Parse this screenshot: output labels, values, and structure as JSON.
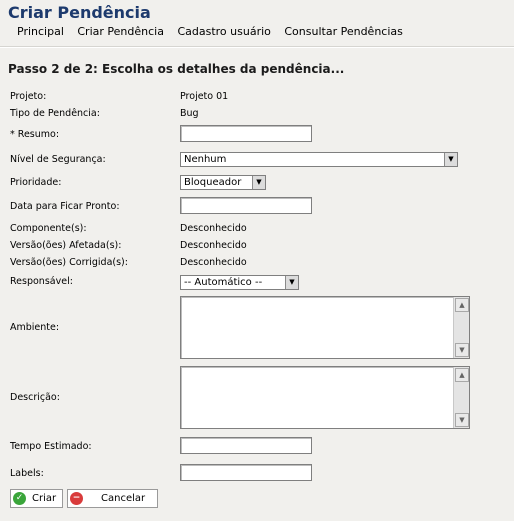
{
  "app": {
    "title": "Criar Pendência"
  },
  "nav": {
    "items": [
      "Principal",
      "Criar Pendência",
      "Cadastro usuário",
      "Consultar Pendências"
    ]
  },
  "page": {
    "step_title": "Passo 2 de 2: Escolha os detalhes da pendência..."
  },
  "form": {
    "projeto": {
      "label": "Projeto:",
      "value": "Projeto 01"
    },
    "tipo": {
      "label": "Tipo de Pendência:",
      "value": "Bug"
    },
    "resumo": {
      "label": "* Resumo:",
      "value": ""
    },
    "seguranca": {
      "label": "Nível de Segurança:",
      "selected": "Nenhum"
    },
    "prioridade": {
      "label": "Prioridade:",
      "selected": "Bloqueador"
    },
    "data_pronto": {
      "label": "Data para Ficar Pronto:",
      "value": ""
    },
    "componentes": {
      "label": "Componente(s):",
      "value": "Desconhecido"
    },
    "versoes_afetadas": {
      "label": "Versão(ões) Afetada(s):",
      "value": "Desconhecido"
    },
    "versoes_corrigidas": {
      "label": "Versão(ões) Corrigida(s):",
      "value": "Desconhecido"
    },
    "responsavel": {
      "label": "Responsável:",
      "selected": "-- Automático --"
    },
    "ambiente": {
      "label": "Ambiente:",
      "value": ""
    },
    "descricao": {
      "label": "Descrição:",
      "value": ""
    },
    "tempo_estimado": {
      "label": "Tempo Estimado:",
      "value": ""
    },
    "labels": {
      "label": "Labels:",
      "value": ""
    }
  },
  "buttons": {
    "criar": {
      "label": "Criar",
      "icon": "check-icon",
      "color": "#3aa53a"
    },
    "cancelar": {
      "label": "Cancelar",
      "icon": "cancel-icon",
      "color": "#d93b3b"
    }
  }
}
